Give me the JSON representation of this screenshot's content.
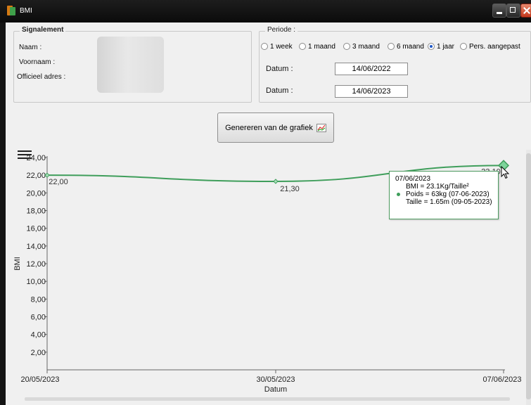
{
  "window": {
    "title": "BMI"
  },
  "signalement": {
    "title": "Signalement",
    "naam_label": "Naam :",
    "voornaam_label": "Voornaam :",
    "adres_label": "Officieel adres :"
  },
  "periode": {
    "title": "Periode :",
    "options": [
      "1 week",
      "1 maand",
      "3 maand",
      "6 maand",
      "1 jaar",
      "Pers. aangepast"
    ],
    "selected": "1 jaar",
    "date_label_1": "Datum :",
    "date_value_1": "14/06/2022",
    "date_label_2": "Datum :",
    "date_value_2": "14/06/2023"
  },
  "generate_button": {
    "label": "Genereren van de grafiek"
  },
  "chart_data": {
    "type": "line",
    "ylabel": "BMI",
    "xlabel": "Datum",
    "ylim": [
      0,
      24
    ],
    "y_ticks": [
      "2,00",
      "4,00",
      "6,00",
      "8,00",
      "10,00",
      "12,00",
      "14,00",
      "16,00",
      "18,00",
      "20,00",
      "22,00",
      "24,00"
    ],
    "x_ticks": [
      "20/05/2023",
      "30/05/2023",
      "07/06/2023"
    ],
    "series": [
      {
        "values": [
          22.0,
          21.3,
          23.1
        ]
      }
    ],
    "data_labels": [
      "22,00",
      "21,30",
      "23,10"
    ],
    "line_color": "#3f9e5b",
    "grid": false
  },
  "tooltip": {
    "date": "07/06/2023",
    "bmi": "BMI = 23.1Kg/Taille²",
    "poids": "Poids = 63kg (07-06-2023)",
    "taille": "Taille = 1.65m (09-05-2023)"
  }
}
